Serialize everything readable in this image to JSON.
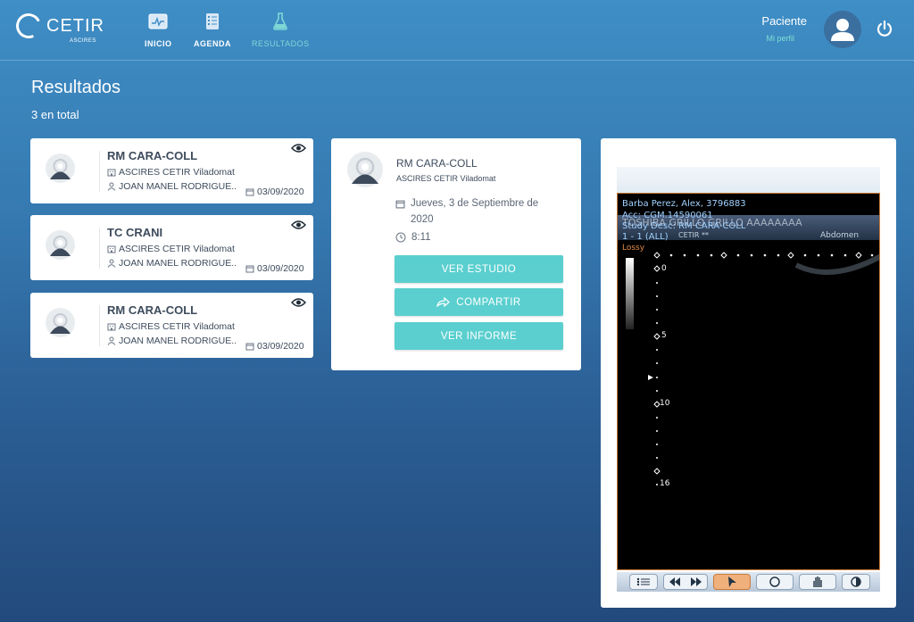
{
  "header": {
    "logo_text": "CETIR",
    "logo_sub": "ASCIRES",
    "nav": [
      {
        "label": "INICIO",
        "icon": "chart-monitor-icon"
      },
      {
        "label": "AGENDA",
        "icon": "clipboard-list-icon"
      },
      {
        "label": "RESULTADOS",
        "icon": "flask-icon",
        "active": true
      }
    ],
    "user_name": "Paciente",
    "user_link": "Mi perfil"
  },
  "page": {
    "title": "Resultados",
    "count": "3 en total"
  },
  "results": [
    {
      "title": "RM CARA-COLL",
      "center": "ASCIRES CETIR Viladomat",
      "doctor": "JOAN MANEL RODRIGUE...",
      "date": "03/09/2020"
    },
    {
      "title": "TC CRANI",
      "center": "ASCIRES CETIR Viladomat",
      "doctor": "JOAN MANEL RODRIGUE...",
      "date": "03/09/2020"
    },
    {
      "title": "RM CARA-COLL",
      "center": "ASCIRES CETIR Viladomat",
      "doctor": "JOAN MANEL RODRIGUE...",
      "date": "03/09/2020"
    }
  ],
  "detail": {
    "title": "RM CARA-COLL",
    "center": "ASCIRES CETIR Viladomat",
    "date": "Jueves, 3 de Septiembre de 2020",
    "time": "8:11",
    "btn_study": "VER ESTUDIO",
    "btn_share": "COMPARTIR",
    "btn_report": "VER INFORME"
  },
  "viewer": {
    "line1": "Barba Perez, Alex, 3796883",
    "line2": "Acc: CGM.14590061",
    "line3": "Study Desc: RM CARA-COLL",
    "line4": "1 - 1 (ALL)",
    "overlay": "TOSHIBA  GRILLO GRILLO AAAAAAAA",
    "overlay2": "CETIR **",
    "region": "Abdomen",
    "lossy": "Lossy",
    "ticks": [
      "0",
      "5",
      "10",
      "16"
    ]
  },
  "colors": {
    "accent": "#5bcfcf",
    "active_nav": "#7fd6d6",
    "text_dark": "#3d4b5c"
  }
}
